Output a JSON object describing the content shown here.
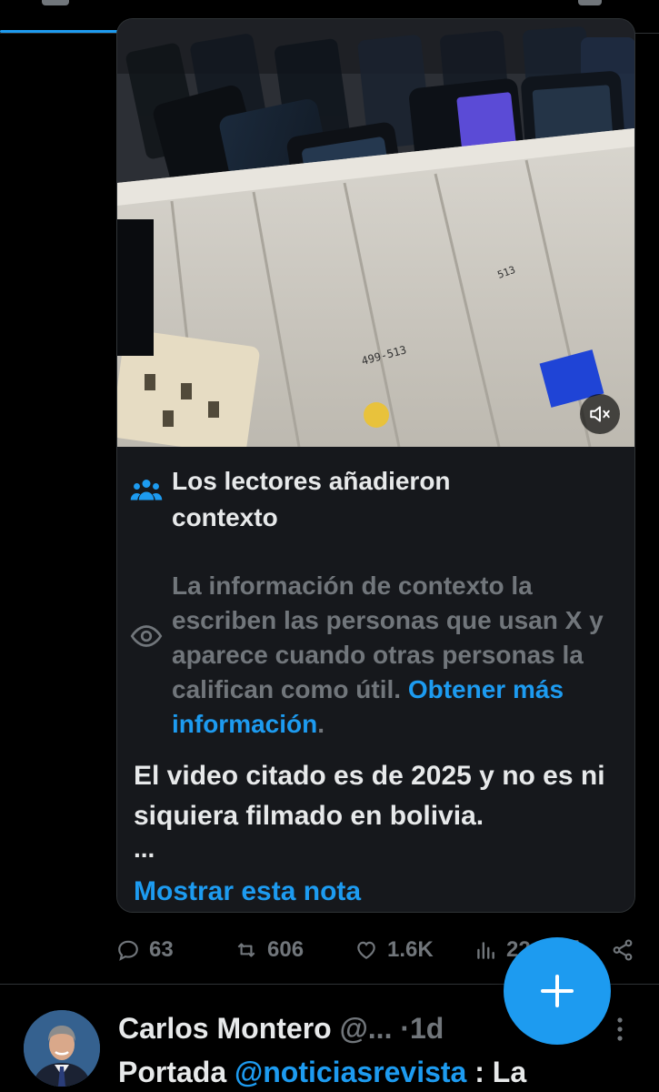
{
  "note": {
    "title": "Los lectores añadieron contexto",
    "info": "La información de contexto la escriben las personas que usan X y aparece cuando otras personas la califican como útil.",
    "info_link": "Obtener más información",
    "body": "El video citado es de 2025 y no es ni siquiera filmado en bolivia.",
    "ellipsis": "...",
    "show_label": "Mostrar esta nota"
  },
  "media": {
    "mute_icon": "speaker-muted-icon"
  },
  "actions": {
    "replies": "63",
    "reposts": "606",
    "likes": "1.6K",
    "views": "22"
  },
  "next_tweet": {
    "name": "Carlos Montero",
    "handle": "@...",
    "separator": "·",
    "time": "1d",
    "text_prefix": "Portada",
    "mention": "@noticiasrevista",
    "text_suffix": ": La"
  },
  "fab": {
    "icon": "compose-plus-icon"
  },
  "colors": {
    "accent": "#1d9bf0",
    "muted": "#71767b",
    "background": "#000000",
    "card": "#16181c"
  }
}
